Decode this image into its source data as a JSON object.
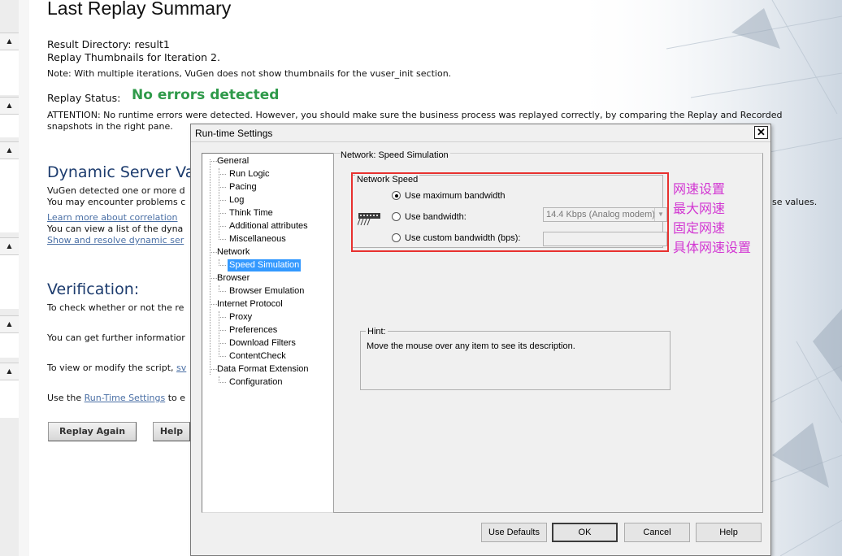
{
  "page": {
    "title": "Last Replay Summary",
    "result_directory": "Result Directory: result1",
    "thumbnails_line": "Replay Thumbnails for Iteration 2.",
    "note": "Note: With multiple iterations, VuGen does not show thumbnails for the vuser_init section.",
    "replay_status_label": "Replay Status:",
    "replay_status_value": "No errors detected",
    "attention_line1": "ATTENTION: No runtime errors were detected. However, you should make sure the business process was replayed correctly, by comparing the Replay and Recorded",
    "attention_line2": "snapshots in the right pane.",
    "dynamic_heading": "Dynamic Server Va",
    "dynamic_line1": "VuGen detected one or more d",
    "dynamic_line2": "You may encounter problems c",
    "dynamic_line2_tail": "se values.",
    "dynamic_link1": "Learn more about correlation",
    "dynamic_line3": "You can view a list of the dyna",
    "dynamic_link2": "Show and resolve dynamic ser",
    "verification_heading": "Verification:",
    "verification_line1": "To check whether or not the re",
    "verification_line2": "You can get further informatior",
    "verification_line3_prefix": "To view or modify the script,",
    "verification_line3_link": "sv",
    "verification_line4_prefix": "Use the",
    "verification_line4_link": "Run-Time Settings",
    "verification_line4_suffix": "to e",
    "replay_again_label": "Replay Again",
    "help_label": "Help"
  },
  "collapse_buttons": [
    {
      "symbol": "▲"
    },
    {
      "symbol": "▲"
    },
    {
      "symbol": "▲"
    },
    {
      "symbol": "▲"
    },
    {
      "symbol": "▲"
    },
    {
      "symbol": "▲"
    }
  ],
  "dialog": {
    "title": "Run-time Settings",
    "close_symbol": "✕",
    "tree": {
      "general": "General",
      "run_logic": "Run Logic",
      "pacing": "Pacing",
      "log": "Log",
      "think_time": "Think Time",
      "additional_attributes": "Additional attributes",
      "miscellaneous": "Miscellaneous",
      "network": "Network",
      "speed_simulation": "Speed Simulation",
      "browser": "Browser",
      "browser_emulation": "Browser Emulation",
      "internet_protocol": "Internet Protocol",
      "proxy": "Proxy",
      "preferences": "Preferences",
      "download_filters": "Download Filters",
      "content_check": "ContentCheck",
      "data_format_extension": "Data Format Extension",
      "configuration": "Configuration"
    },
    "panel_title": "Network: Speed Simulation",
    "network_speed_legend": "Network Speed",
    "options": {
      "max_bandwidth": "Use maximum bandwidth",
      "use_bandwidth": "Use bandwidth:",
      "custom_bandwidth": "Use custom bandwidth (bps):"
    },
    "selected_option": "max_bandwidth",
    "bandwidth_value": "14.4 Kbps (Analog modem)",
    "custom_value": "",
    "hint_legend": "Hint:",
    "hint_text": "Move the mouse over any item to see its description.",
    "buttons": {
      "use_defaults": "Use Defaults",
      "ok": "OK",
      "cancel": "Cancel",
      "help": "Help"
    }
  },
  "annotations": {
    "line1": "网速设置",
    "line2": "最大网速",
    "line3": "固定网速",
    "line4": "具体网速设置"
  },
  "colors": {
    "status_green": "#2f9a4a",
    "highlight_red": "#e8312f",
    "annotation_magenta": "#d236d2",
    "selection_blue": "#3399ff",
    "heading_blue": "#1d3c6e"
  }
}
